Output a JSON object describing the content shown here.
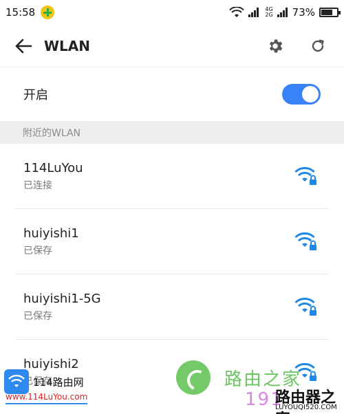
{
  "status_bar": {
    "time": "15:58",
    "net_top": "4G",
    "net_bottom": "2G",
    "battery_percent": "73%",
    "battery_level": 0.73
  },
  "app_bar": {
    "title": "WLAN"
  },
  "toggle": {
    "label": "开启",
    "enabled": true
  },
  "section": {
    "title": "附近的WLAN"
  },
  "networks": [
    {
      "name": "114LuYou",
      "status": "已连接"
    },
    {
      "name": "huiyishi1",
      "status": "已保存"
    },
    {
      "name": "huiyishi1-5G",
      "status": "已保存"
    },
    {
      "name": "huiyishi2",
      "status": "已保存"
    }
  ],
  "watermarks": {
    "left_brand": "114路由网",
    "left_url": "www.114LuYou.com",
    "right_cn": "路由之家",
    "right_num": "191",
    "right_cn2": "路由器之家",
    "right_domain": "LUYOUQI520.COM"
  },
  "colors": {
    "accent": "#3a82f7",
    "wifi_icon": "#1e88e5"
  }
}
